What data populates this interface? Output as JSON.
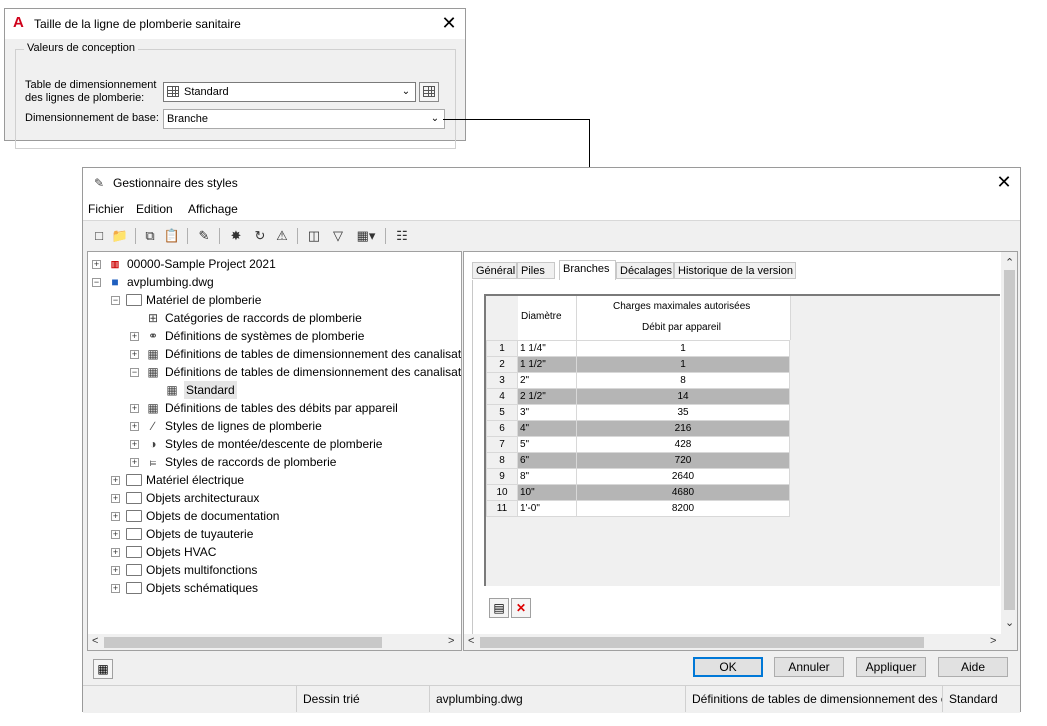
{
  "dialog1": {
    "title": "Taille de la ligne de plomberie sanitaire",
    "group": "Valeurs de conception",
    "table_label_1": "Table de dimensionnement",
    "table_label_2": "des lignes de plomberie:",
    "table_value": "Standard",
    "base_label": "Dimensionnement de base:",
    "base_value": "Branche"
  },
  "manager": {
    "title": "Gestionnaire des styles",
    "menu": [
      "Fichier",
      "Edition",
      "Affichage"
    ],
    "tree": [
      "00000-Sample Project 2021",
      "avplumbing.dwg",
      "Matériel de plomberie",
      "Catégories de raccords de plomberie",
      "Définitions de systèmes de plomberie",
      "Définitions de tables de dimensionnement des canalisat",
      "Définitions de tables de dimensionnement des canalisat",
      "Standard",
      "Définitions de tables des débits par appareil",
      "Styles de lignes de plomberie",
      "Styles de montée/descente de plomberie",
      "Styles de raccords de plomberie",
      "Matériel électrique",
      "Objets architecturaux",
      "Objets de documentation",
      "Objets de tuyauterie",
      "Objets HVAC",
      "Objets multifonctions",
      "Objets schématiques"
    ],
    "tabs": [
      "Général",
      "Piles",
      "Branches",
      "Décalages",
      "Historique de la version"
    ],
    "selected_tab": "Branches",
    "table": {
      "col_diametre": "Diamètre",
      "col_charges": "Charges maximales autorisées",
      "col_debit": "Débit par appareil",
      "rows": [
        {
          "n": "1",
          "d": "1 1/4\"",
          "v": "1"
        },
        {
          "n": "2",
          "d": "1 1/2\"",
          "v": "1"
        },
        {
          "n": "3",
          "d": "2\"",
          "v": "8"
        },
        {
          "n": "4",
          "d": "2 1/2\"",
          "v": "14"
        },
        {
          "n": "5",
          "d": "3\"",
          "v": "35"
        },
        {
          "n": "6",
          "d": "4\"",
          "v": "216"
        },
        {
          "n": "7",
          "d": "5\"",
          "v": "428"
        },
        {
          "n": "8",
          "d": "6\"",
          "v": "720"
        },
        {
          "n": "9",
          "d": "8\"",
          "v": "2640"
        },
        {
          "n": "10",
          "d": "10\"",
          "v": "4680"
        },
        {
          "n": "11",
          "d": "1'-0\"",
          "v": "8200"
        }
      ]
    },
    "buttons": {
      "ok": "OK",
      "cancel": "Annuler",
      "apply": "Appliquer",
      "help": "Aide"
    },
    "status": {
      "s1": "Dessin trié",
      "s2": "avplumbing.dwg",
      "s3": "Définitions de tables de dimensionnement des c",
      "s4": "Standard"
    }
  }
}
